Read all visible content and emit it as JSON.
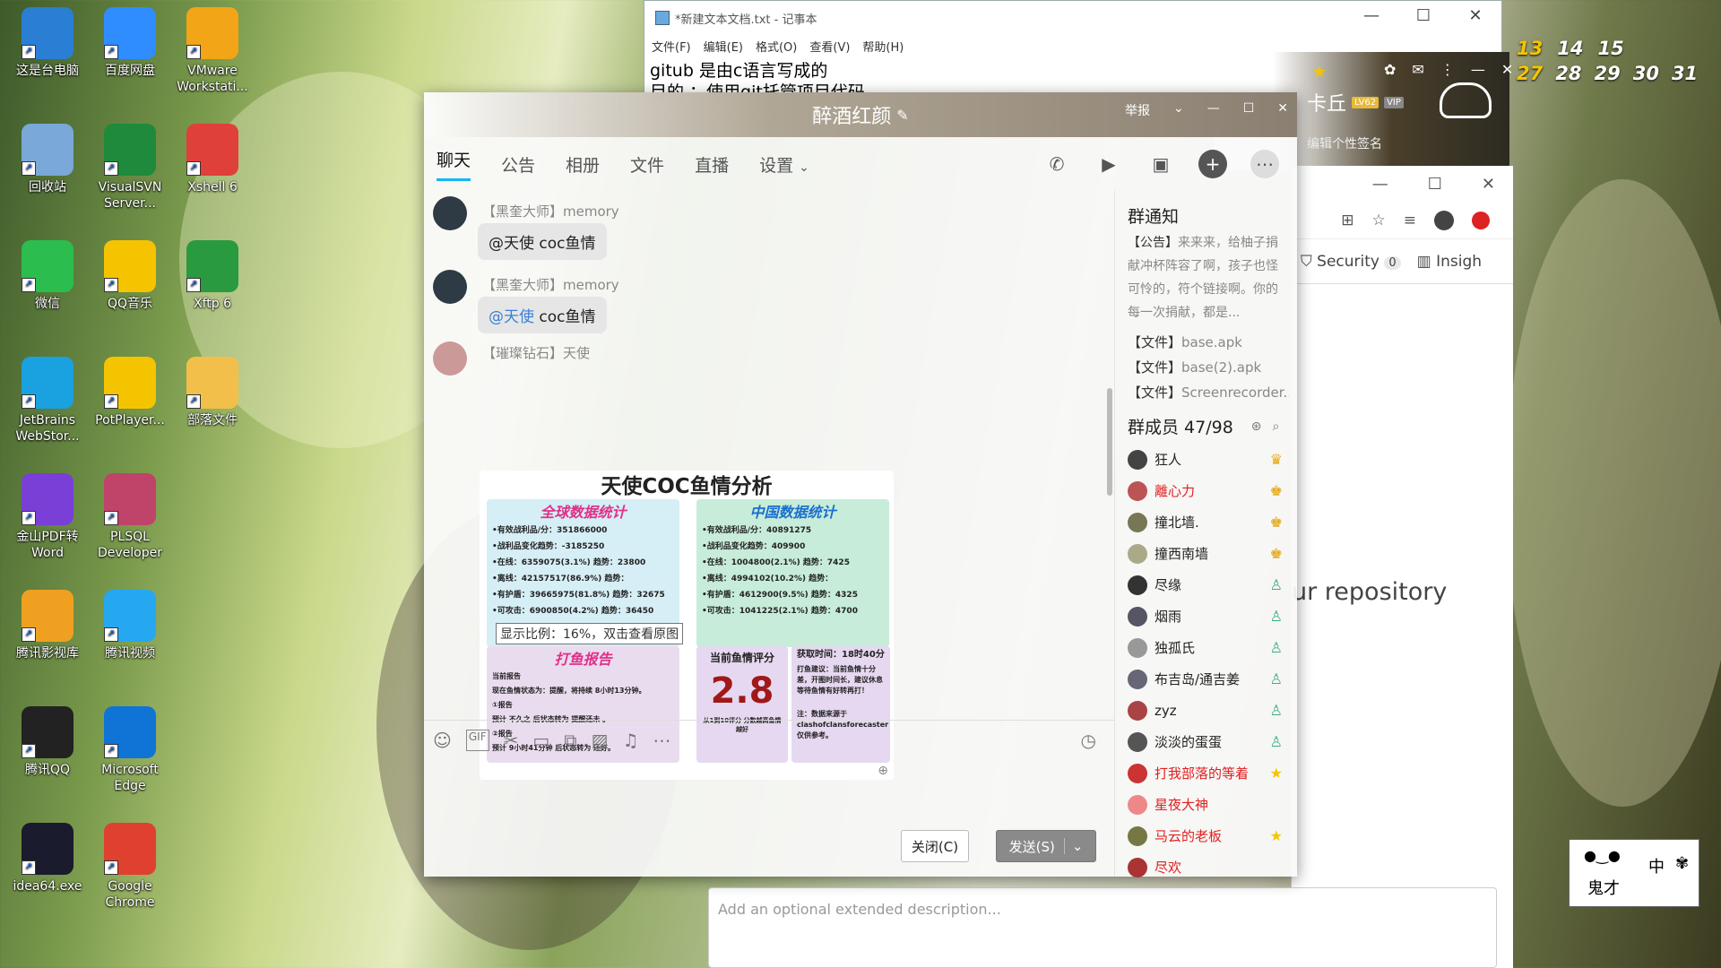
{
  "desktop_icons": [
    {
      "label": "这是台电脑",
      "icon": "computer-icon",
      "color": "#2a7fd4"
    },
    {
      "label": "百度网盘",
      "icon": "baidu-netdisk-icon",
      "color": "#2f8dff"
    },
    {
      "label": "VMware Workstati...",
      "icon": "vmware-icon",
      "color": "#f2a516"
    },
    {
      "label": "回收站",
      "icon": "recycle-bin-icon",
      "color": "#7aa8d8"
    },
    {
      "label": "VisualSVN Server...",
      "icon": "visualsvn-icon",
      "color": "#1f8a3b"
    },
    {
      "label": "Xshell 6",
      "icon": "xshell-icon",
      "color": "#e0403a"
    },
    {
      "label": "微信",
      "icon": "wechat-icon",
      "color": "#2bbd4d"
    },
    {
      "label": "QQ音乐",
      "icon": "qq-music-icon",
      "color": "#f6c300"
    },
    {
      "label": "Xftp 6",
      "icon": "xftp-icon",
      "color": "#2a9a40"
    },
    {
      "label": "JetBrains WebStor...",
      "icon": "webstorm-icon",
      "color": "#1aa1e0"
    },
    {
      "label": "PotPlayer...",
      "icon": "potplayer-icon",
      "color": "#f5c400"
    },
    {
      "label": "部落文件",
      "icon": "folder-icon",
      "color": "#f2c04a"
    },
    {
      "label": "金山PDF转 Word",
      "icon": "pdf-convert-icon",
      "color": "#7a3fd6"
    },
    {
      "label": "PLSQL Developer",
      "icon": "plsql-icon",
      "color": "#c0436a"
    },
    {
      "label": "腾讯影视库",
      "icon": "tencent-video-lib-icon",
      "color": "#f0a020"
    },
    {
      "label": "腾讯视频",
      "icon": "tencent-video-icon",
      "color": "#25a8f0"
    },
    {
      "label": "腾讯QQ",
      "icon": "qq-icon",
      "color": "#222222"
    },
    {
      "label": "Microsoft Edge",
      "icon": "edge-icon",
      "color": "#1073d6"
    },
    {
      "label": "idea64.exe",
      "icon": "intellij-icon",
      "color": "#1b1b2e"
    },
    {
      "label": "Google Chrome",
      "icon": "chrome-icon",
      "color": "#e04030"
    }
  ],
  "notepad": {
    "title": "*新建文本文档.txt - 记事本",
    "menu": [
      "文件(F)",
      "编辑(E)",
      "格式(O)",
      "查看(V)",
      "帮助(H)"
    ],
    "lines": [
      "gitub 是由c语言写成的",
      "目的 ：使用git托管项目代码"
    ]
  },
  "calendar_numbers": [
    "13",
    "14",
    "15",
    "27",
    "28",
    "29",
    "30",
    "31"
  ],
  "qq_profile": {
    "name_fragment": "卡丘",
    "level": "LV62",
    "badge": "VIP",
    "signature": "编辑个性签名"
  },
  "browser": {
    "tab1": "Security",
    "tab1_count": "0",
    "tab2": "Insigh",
    "repo_text": "ur repository",
    "desc_placeholder": "Add an optional extended description..."
  },
  "chat": {
    "title": "醉酒红颜",
    "report": "举报",
    "tabs": [
      "聊天",
      "公告",
      "相册",
      "文件",
      "直播",
      "设置"
    ],
    "messages": [
      {
        "name": "【黑奎大师】memory",
        "text": "@天使 coc鱼情",
        "at": ""
      },
      {
        "name": "【黑奎大师】memory",
        "at": "@天使",
        "text": " coc鱼情"
      },
      {
        "name": "【璀璨钻石】天使",
        "text": "",
        "at": ""
      }
    ],
    "image": {
      "title": "天使COC鱼情分析",
      "global_title": "全球数据统计",
      "china_title": "中国数据统计",
      "global_rows": [
        "•有效战利品/分：351866000",
        "•战利品变化趋势：-3185250",
        "•在线：6359075(3.1%)  趋势：23800",
        "•离线：42157517(86.9%)  趋势：",
        "•有护盾：39665975(81.8%) 趋势：32675",
        "•可攻击：6900850(4.2%) 趋势：36450"
      ],
      "china_rows": [
        "•有效战利品/分：40891275",
        "•战利品变化趋势：409900",
        "•在线：1004800(2.1%)  趋势：7425",
        "•离线：4994102(10.2%)  趋势：",
        "•有护盾：4612900(9.5%)  趋势：4325",
        "•可攻击：1041225(2.1%)  趋势：4700"
      ],
      "fish_title": "打鱼报告",
      "fish_rows": [
        "当前报告",
        "现在鱼情状态为：提醒，将持续 8小时13分钟。",
        "①报告",
        "预计 不久之 后状态转为 提醒还未 。",
        "②报告",
        "预计 9小时41分钟 后状态转为 还好。"
      ],
      "score_title": "当前鱼情评分",
      "score": "2.8",
      "score_note": "从1到10评分 分数越高鱼情越好",
      "time_title": "获取时间：18时40分",
      "advice": "打鱼建议：当前鱼情十分差，开图时间长，建议休息等待鱼情有好转再打！",
      "source": "注：数据来源于 clashofclansforecaster 仅供参考。",
      "zoom_tooltip": "显示比例：16%，双击查看原图"
    },
    "close_btn": "关闭(C)",
    "send_btn": "发送(S)",
    "notice_title": "群通知",
    "notice_label": "【公告】",
    "notice_text": "来来来，给柚子捐献冲杯阵容了啊，孩子也怪可怜的，符个链接啊。你的每一次捐献，都是...",
    "files": [
      {
        "tag": "【文件】",
        "name": "base.apk"
      },
      {
        "tag": "【文件】",
        "name": "base(2).apk"
      },
      {
        "tag": "【文件】",
        "name": "Screenrecorder..."
      }
    ],
    "members_title": "群成员 47/98",
    "members": [
      {
        "name": "狂人",
        "color": "#222222",
        "role": "owner"
      },
      {
        "name": "離心力",
        "color": "#e02020",
        "role": "admin"
      },
      {
        "name": "撞北墙.",
        "color": "#222222",
        "role": "admin"
      },
      {
        "name": "撞西南墙",
        "color": "#222222",
        "role": "admin"
      },
      {
        "name": "尽缘",
        "color": "#222222",
        "role": "member"
      },
      {
        "name": "烟雨",
        "color": "#222222",
        "role": "member"
      },
      {
        "name": "独孤氏",
        "color": "#222222",
        "role": "member"
      },
      {
        "name": "布吉岛/通吉姜",
        "color": "#222222",
        "role": "member"
      },
      {
        "name": "zyz",
        "color": "#222222",
        "role": "member"
      },
      {
        "name": "淡淡的蛋蛋",
        "color": "#222222",
        "role": "member"
      },
      {
        "name": "打我部落的等着",
        "color": "#e02020",
        "role": "star"
      },
      {
        "name": "星夜大神",
        "color": "#e02020",
        "role": "none"
      },
      {
        "name": "马云的老板",
        "color": "#e02020",
        "role": "star"
      },
      {
        "name": "尽欢",
        "color": "#e02020",
        "role": "none"
      }
    ]
  },
  "ime": {
    "ch": "中",
    "text": "鬼才"
  }
}
